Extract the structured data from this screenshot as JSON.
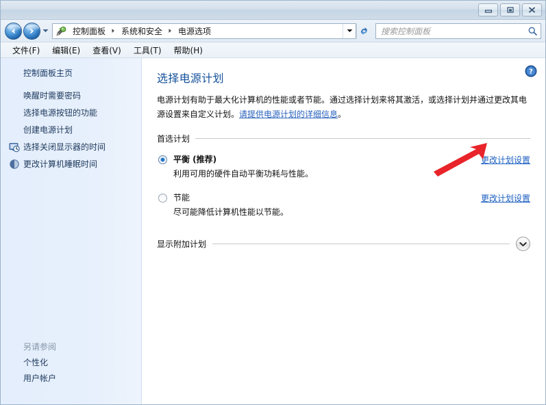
{
  "window": {
    "controls": {
      "minimize": "minimize-button",
      "maximize": "maximize-button",
      "close": "close-button"
    }
  },
  "addressbar": {
    "back_title": "后退",
    "forward_title": "前进",
    "icon": "power-plug-icon",
    "crumbs": [
      "控制面板",
      "系统和安全",
      "电源选项"
    ],
    "dropdown": "chevron-down-icon",
    "refresh": "refresh-icon"
  },
  "search": {
    "placeholder": "搜索控制面板",
    "icon": "search-icon"
  },
  "menu": {
    "items": [
      "文件(F)",
      "编辑(E)",
      "查看(V)",
      "工具(T)",
      "帮助(H)"
    ]
  },
  "sidebar": {
    "home": "控制面板主页",
    "items": [
      {
        "label": "唤醒时需要密码",
        "icon": ""
      },
      {
        "label": "选择电源按钮的功能",
        "icon": ""
      },
      {
        "label": "创建电源计划",
        "icon": ""
      },
      {
        "label": "选择关闭显示器的时间",
        "icon": "monitor-clock-icon"
      },
      {
        "label": "更改计算机睡眠时间",
        "icon": "sleep-moon-icon"
      }
    ],
    "see_also_title": "另请参阅",
    "see_also": [
      "个性化",
      "用户帐户"
    ]
  },
  "main": {
    "help_icon": "help-icon",
    "title": "选择电源计划",
    "desc_part1": "电源计划有助于最大化计算机的性能或者节能。通过选择计划来将其激活，或选择计划并通过更改其电源设置来自定义计划。",
    "desc_link": "请提供电源计划的详细信息",
    "desc_part2": "。",
    "group_title": "首选计划",
    "plans": [
      {
        "name": "平衡 (推荐)",
        "desc": "利用可用的硬件自动平衡功耗与性能。",
        "selected": true,
        "change_link": "更改计划设置"
      },
      {
        "name": "节能",
        "desc": "尽可能降低计算机性能以节能。",
        "selected": false,
        "change_link": "更改计划设置"
      }
    ],
    "show_more": "显示附加计划",
    "show_more_icon": "chevron-down-icon"
  },
  "annotation": {
    "arrow": "red-arrow-annotation",
    "color": "#e8242a"
  },
  "colors": {
    "title_link": "#14519b",
    "link": "#1b5fc0",
    "sidebar_bg": "#e7f0fc",
    "titlebar": "#cfdce8"
  }
}
